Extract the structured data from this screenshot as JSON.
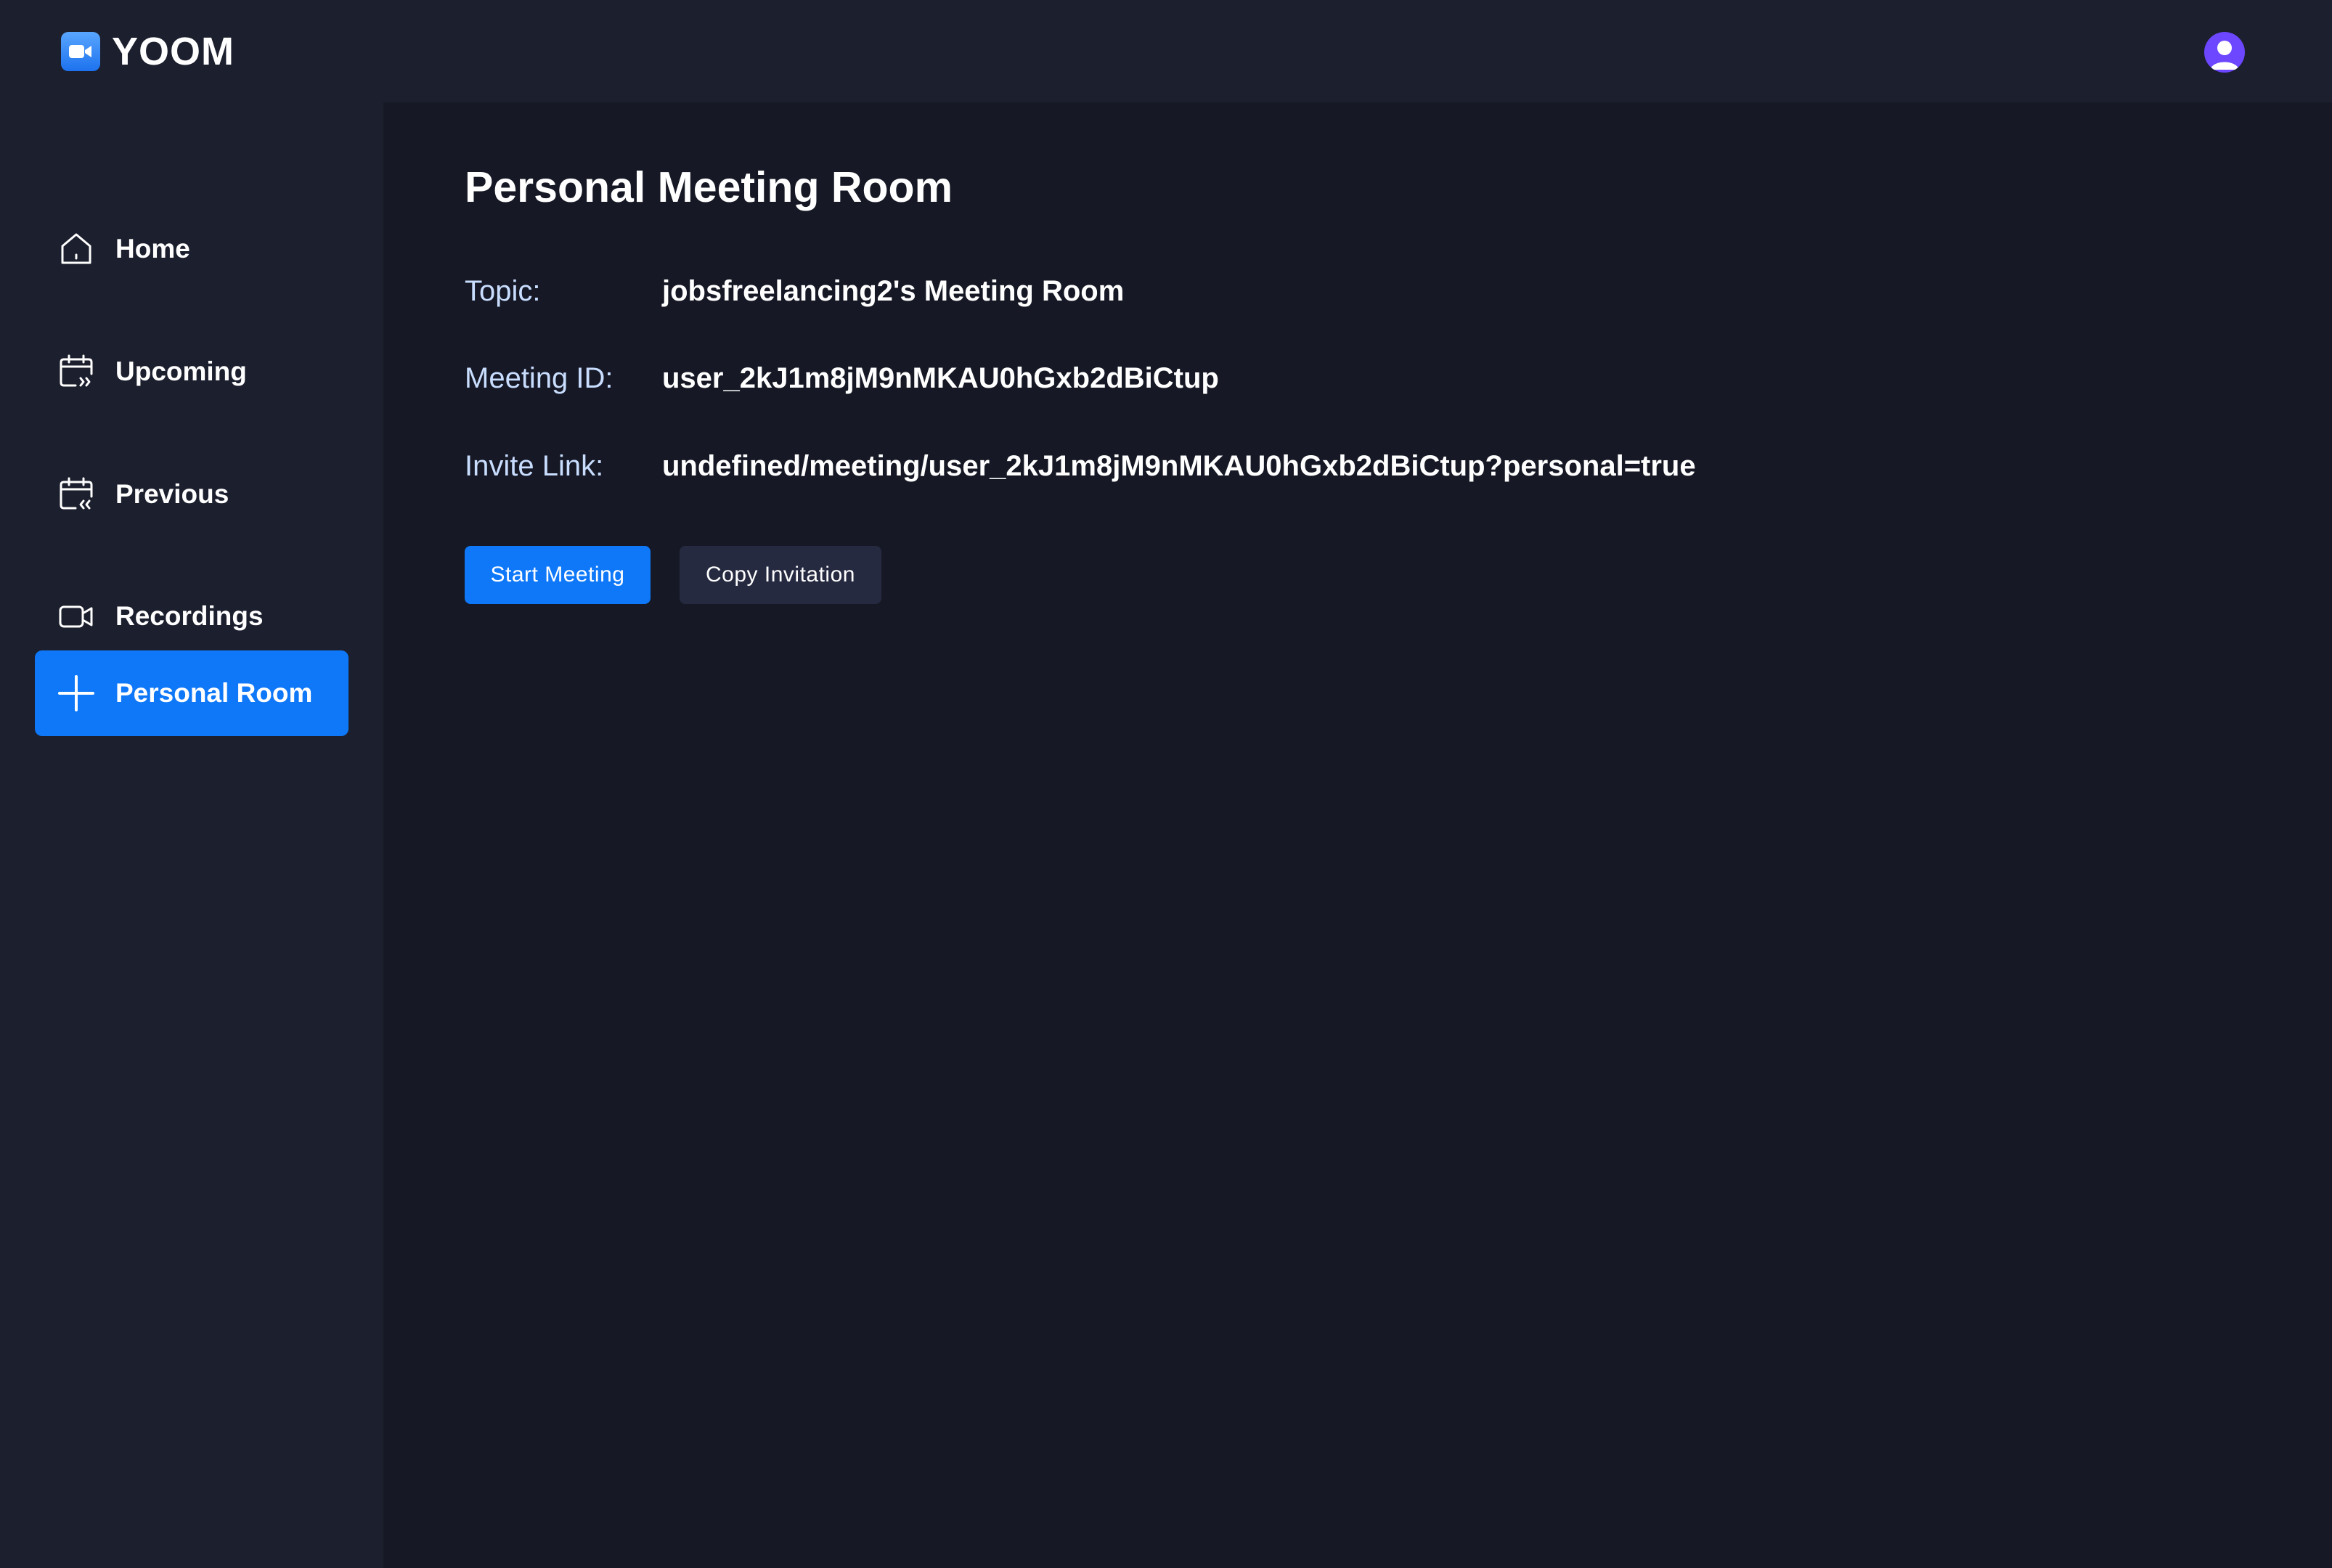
{
  "brand": {
    "name": "YOOM"
  },
  "sidebar": {
    "items": [
      {
        "label": "Home",
        "icon": "home-icon",
        "active": false
      },
      {
        "label": "Upcoming",
        "icon": "calendar-forward-icon",
        "active": false
      },
      {
        "label": "Previous",
        "icon": "calendar-back-icon",
        "active": false
      },
      {
        "label": "Recordings",
        "icon": "video-icon",
        "active": false
      },
      {
        "label": "Personal Room",
        "icon": "plus-icon",
        "active": true
      }
    ]
  },
  "main": {
    "title": "Personal Meeting Room",
    "topic": {
      "label": "Topic:",
      "value": "jobsfreelancing2's Meeting Room"
    },
    "meeting_id": {
      "label": "Meeting ID:",
      "value": "user_2kJ1m8jM9nMKAU0hGxb2dBiCtup"
    },
    "invite_link": {
      "label": "Invite Link:",
      "value": "undefined/meeting/user_2kJ1m8jM9nMKAU0hGxb2dBiCtup?personal=true"
    },
    "buttons": {
      "start": "Start Meeting",
      "copy": "Copy Invitation"
    }
  },
  "colors": {
    "accent": "#0e78f9",
    "sidebar_bg": "#1c1f2e",
    "main_bg": "#161925",
    "secondary_button": "#252a41",
    "label_text": "#c9ddff",
    "avatar": "#6c47ff"
  }
}
